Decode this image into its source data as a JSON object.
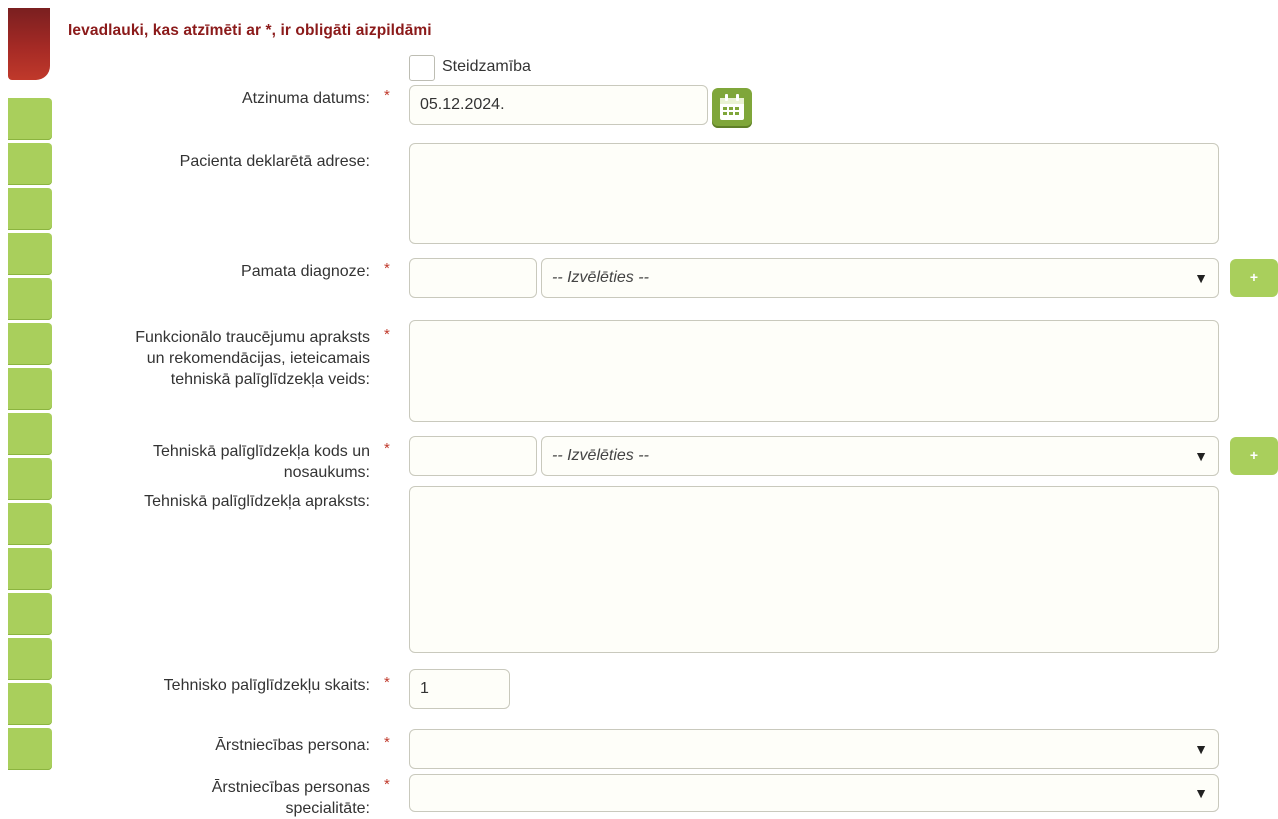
{
  "notice": "Ievadlauki, kas atzīmēti ar *, ir obligāti aizpildāmi",
  "required_mark": "*",
  "urgency": {
    "label": "Steidzamība",
    "checked": false
  },
  "opinion_date": {
    "label": "Atzinuma datums:",
    "value": "05.12.2024.",
    "calendar_icon": "calendar-icon"
  },
  "declared_address": {
    "label": "Pacienta deklarētā adrese:",
    "value": ""
  },
  "main_diagnosis": {
    "label": "Pamata diagnoze:",
    "code": "",
    "select": "-- Izvēlēties --",
    "add_label": "+"
  },
  "functional_description": {
    "label_lines": [
      "Funkcionālo traucējumu apraksts",
      "un rekomendācijas, ieteicamais",
      "tehniskā palīglīdzekļa veids:"
    ],
    "value": ""
  },
  "aid_code": {
    "label_lines": [
      "Tehniskā palīglīdzekļa kods un",
      "nosaukums:"
    ],
    "code": "",
    "select": "-- Izvēlēties --",
    "add_label": "+"
  },
  "aid_description": {
    "label": "Tehniskā palīglīdzekļa apraksts:",
    "value": ""
  },
  "aid_count": {
    "label": "Tehnisko palīglīdzekļu skaits:",
    "value": "1"
  },
  "practitioner": {
    "label": "Ārstniecības persona:",
    "value": ""
  },
  "practitioner_specialty": {
    "label_lines": [
      "Ārstniecības personas",
      "specialitāte:"
    ],
    "value": ""
  },
  "dropdown_arrow": "▼",
  "colors": {
    "accent_green": "#a9cf5c",
    "notice_red": "#8b1a1a",
    "required_red": "#c0392b"
  }
}
